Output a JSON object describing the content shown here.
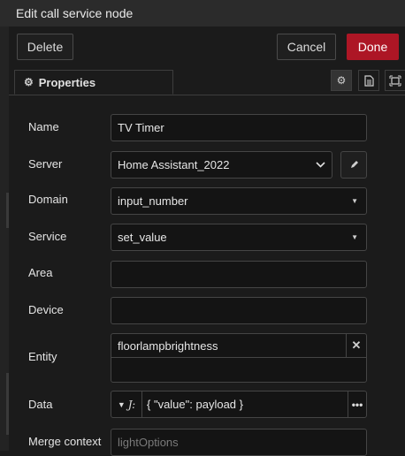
{
  "window": {
    "title": "Edit call service node"
  },
  "toolbar": {
    "delete_label": "Delete",
    "cancel_label": "Cancel",
    "done_label": "Done",
    "done_color": "#ad1625"
  },
  "tabs": {
    "active_label": "Properties",
    "icons": [
      "gear-icon",
      "description-icon",
      "appearance-icon"
    ]
  },
  "form": {
    "name": {
      "label": "Name",
      "value": "TV Timer"
    },
    "server": {
      "label": "Server",
      "value": "Home Assistant_2022"
    },
    "domain": {
      "label": "Domain",
      "value": "input_number"
    },
    "service": {
      "label": "Service",
      "value": "set_value"
    },
    "area": {
      "label": "Area",
      "value": ""
    },
    "device": {
      "label": "Device",
      "value": ""
    },
    "entity": {
      "label": "Entity",
      "value": "floorlampbrightness"
    },
    "data": {
      "label": "Data",
      "value": "{ \"value\": payload }"
    },
    "merge_context": {
      "label": "Merge context",
      "placeholder": "lightOptions"
    }
  }
}
